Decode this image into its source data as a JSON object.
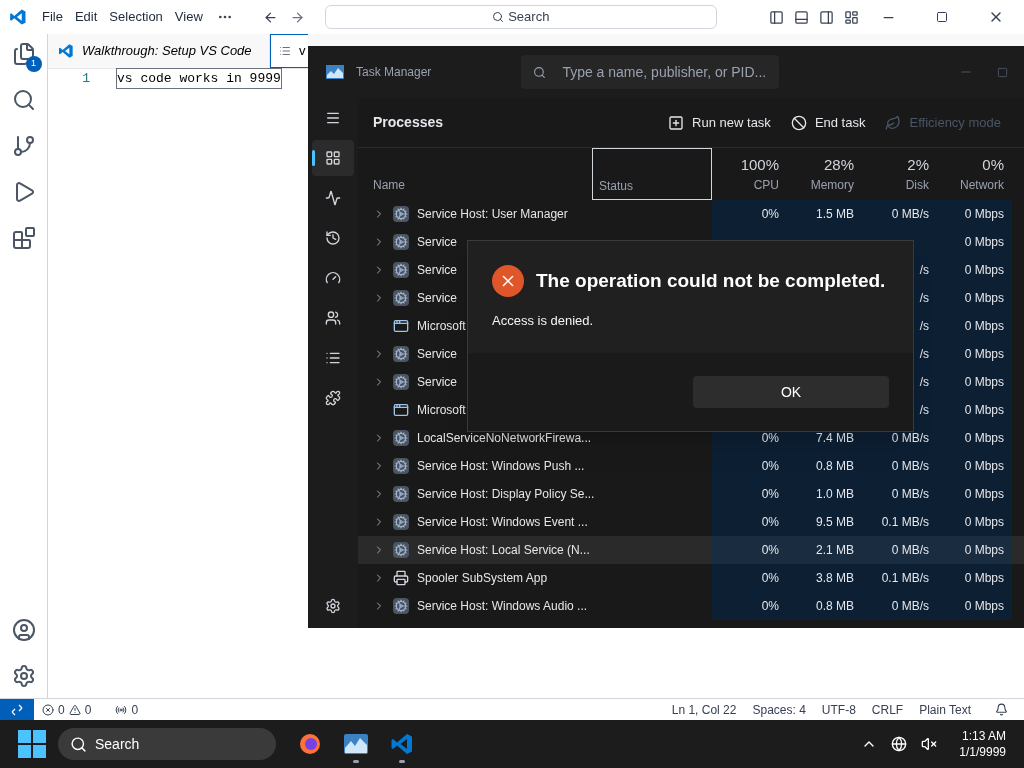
{
  "vscode": {
    "menu": [
      "File",
      "Edit",
      "Selection",
      "View"
    ],
    "search": "Search",
    "explorer_badge": "1",
    "tabs": [
      {
        "label": "Walkthrough: Setup VS Code",
        "preview": true,
        "selected": false
      },
      {
        "label": "v",
        "preview": false,
        "selected": true
      }
    ],
    "lines": [
      {
        "number": "1",
        "text": "vs code works in 9999"
      }
    ],
    "status_bar": {
      "errors": "0",
      "warnings": "0",
      "ports": "0",
      "items": [
        "Ln 1, Col 22",
        "Spaces: 4",
        "UTF-8",
        "CRLF",
        "Plain Text"
      ]
    }
  },
  "task_manager": {
    "title": "Task Manager",
    "search_placeholder": "Type a name, publisher, or PID...",
    "nav": [
      {
        "selected": false
      },
      {
        "selected": true
      },
      {
        "selected": false
      },
      {
        "selected": false
      },
      {
        "selected": false
      },
      {
        "selected": false
      },
      {
        "selected": false
      },
      {
        "selected": false
      }
    ],
    "page_title": "Processes",
    "actions": [
      {
        "label": "Run new task",
        "disabled": false
      },
      {
        "label": "End task",
        "disabled": false
      },
      {
        "label": "Efficiency mode",
        "disabled": true
      }
    ],
    "columns": [
      {
        "label": "Name"
      },
      {
        "label": "Status"
      },
      {
        "percent": "100%",
        "label": "CPU"
      },
      {
        "percent": "28%",
        "label": "Memory"
      },
      {
        "percent": "2%",
        "label": "Disk"
      },
      {
        "percent": "0%",
        "label": "Network"
      }
    ],
    "rows": [
      {
        "name": "Service Host: User Manager",
        "kind": "service",
        "expandable": true,
        "hovered": false,
        "cpu": "0%",
        "memory": "1.5 MB",
        "disk": "0 MB/s",
        "network": "0 Mbps"
      },
      {
        "name": "Service",
        "kind": "service",
        "expandable": true,
        "hovered": false,
        "network": "0 Mbps"
      },
      {
        "name": "Service",
        "kind": "service",
        "expandable": true,
        "hovered": false,
        "disk": "/s",
        "network": "0 Mbps"
      },
      {
        "name": "Service",
        "kind": "service",
        "expandable": true,
        "hovered": false,
        "disk": "/s",
        "network": "0 Mbps"
      },
      {
        "name": "Microsoft",
        "kind": "app",
        "expandable": false,
        "hovered": false,
        "disk": "/s",
        "network": "0 Mbps"
      },
      {
        "name": "Service",
        "kind": "service",
        "expandable": true,
        "hovered": false,
        "disk": "/s",
        "network": "0 Mbps"
      },
      {
        "name": "Service",
        "kind": "service",
        "expandable": true,
        "hovered": false,
        "disk": "/s",
        "network": "0 Mbps"
      },
      {
        "name": "Microsoft",
        "kind": "app",
        "expandable": false,
        "hovered": false,
        "disk": "/s",
        "network": "0 Mbps"
      },
      {
        "name": "LocalServiceNoNetworkFirewa...",
        "kind": "service",
        "expandable": true,
        "hovered": false,
        "cpu": "0%",
        "memory": "7.4 MB",
        "disk": "0 MB/s",
        "network": "0 Mbps"
      },
      {
        "name": "Service Host: Windows Push ...",
        "kind": "service",
        "expandable": true,
        "hovered": false,
        "cpu": "0%",
        "memory": "0.8 MB",
        "disk": "0 MB/s",
        "network": "0 Mbps"
      },
      {
        "name": "Service Host: Display Policy Se...",
        "kind": "service",
        "expandable": true,
        "hovered": false,
        "cpu": "0%",
        "memory": "1.0 MB",
        "disk": "0 MB/s",
        "network": "0 Mbps"
      },
      {
        "name": "Service Host: Windows Event ...",
        "kind": "service",
        "expandable": true,
        "hovered": false,
        "cpu": "0%",
        "memory": "9.5 MB",
        "disk": "0.1 MB/s",
        "network": "0 Mbps"
      },
      {
        "name": "Service Host: Local Service (N...",
        "kind": "service",
        "expandable": true,
        "hovered": true,
        "cpu": "0%",
        "memory": "2.1 MB",
        "disk": "0 MB/s",
        "network": "0 Mbps"
      },
      {
        "name": "Spooler SubSystem App",
        "kind": "printer",
        "expandable": true,
        "hovered": false,
        "cpu": "0%",
        "memory": "3.8 MB",
        "disk": "0.1 MB/s",
        "network": "0 Mbps"
      },
      {
        "name": "Service Host: Windows Audio ...",
        "kind": "service",
        "expandable": true,
        "hovered": false,
        "cpu": "0%",
        "memory": "0.8 MB",
        "disk": "0 MB/s",
        "network": "0 Mbps"
      }
    ]
  },
  "dialog": {
    "title": "The operation could not be completed.",
    "message": "Access is denied.",
    "button": "OK"
  },
  "taskbar": {
    "search": "Search",
    "apps": [
      {
        "running": false
      },
      {
        "running": true
      },
      {
        "running": true
      }
    ],
    "time": "1:13 AM",
    "date": "1/1/9999"
  }
}
